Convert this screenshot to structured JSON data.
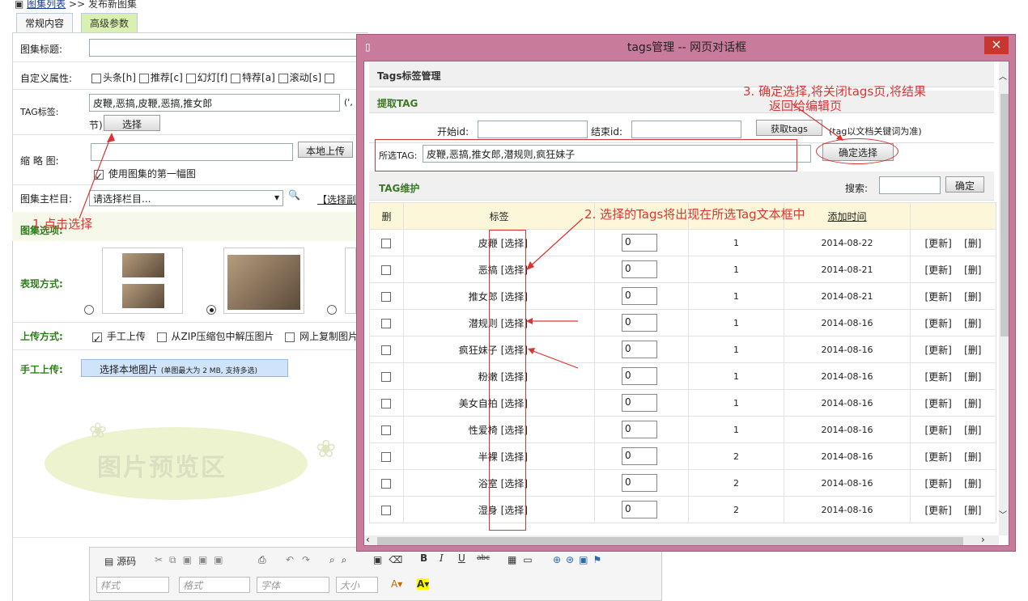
{
  "breadcrumb": {
    "link": "图集列表",
    "sep": ">>",
    "current": "发布新图集"
  },
  "tabs": [
    {
      "label": "常规内容"
    },
    {
      "label": "高级参数"
    }
  ],
  "form": {
    "title_label": "图集标题:",
    "attr_label": "自定义属性:",
    "attrs": [
      "头条[h]",
      "推荐[c]",
      "幻灯[f]",
      "特荐[a]",
      "滚动[s]"
    ],
    "tag_label": "TAG标签:",
    "tag_value": "皮鞭,恶搞,皮鞭,恶搞,推女郎",
    "tag_hint": "(',",
    "tag_hint2": "节)",
    "select_btn": "选择",
    "thumb_label": "缩 略 图:",
    "local_upload": "本地上传",
    "use_first": "使用图集的第一幅图",
    "column_label": "图集主栏目:",
    "column_value": "请选择栏目...",
    "column_link": "【选择副",
    "options_label": "图集选项:",
    "style_label": "表现方式:",
    "upload_label": "上传方式:",
    "upload_opts": [
      "手工上传",
      "从ZIP压缩包中解压图片",
      "网上复制图片"
    ],
    "manual_label": "手工上传:",
    "select_local": "选择本地图片",
    "select_local_hint": "(单图最大为 2 MB, 支持多选)",
    "preview_text": "图片预览区"
  },
  "annotations": {
    "a1": "1.点击选择",
    "a2": "2. 选择的Tags将出现在所选Tag文本框中",
    "a3": "3.  确定选择,将关闭tags页,将结果",
    "a3b": "返回给编辑页"
  },
  "dialog": {
    "title": "tags管理 -- 网页对话框",
    "close": "×",
    "section1": "Tags标签管理",
    "section2": "提取TAG",
    "start_label": "开始id:",
    "end_label": "结束id:",
    "fetch_btn": "获取tags",
    "fetch_hint": "(tag以文档关键词为准)",
    "selected_label": "所选TAG:",
    "selected_value": "皮鞭,恶搞,推女郎,潜规则,疯狂妹子",
    "confirm_btn": "确定选择",
    "section3": "TAG维护",
    "search_label": "搜索:",
    "search_btn": "确定",
    "headers": [
      "删",
      "标签",
      "",
      "",
      "添加时间",
      ""
    ],
    "rows": [
      {
        "tag": "皮鞭",
        "pick": "[选择]",
        "num": "0",
        "count": "1",
        "date": "2014-08-22",
        "upd": "[更新]",
        "del": "[删]"
      },
      {
        "tag": "恶搞",
        "pick": "[选择]",
        "num": "0",
        "count": "1",
        "date": "2014-08-21",
        "upd": "[更新]",
        "del": "[删]"
      },
      {
        "tag": "推女郎",
        "pick": "[选择]",
        "num": "0",
        "count": "1",
        "date": "2014-08-21",
        "upd": "[更新]",
        "del": "[删]"
      },
      {
        "tag": "潜规则",
        "pick": "[选择]",
        "num": "0",
        "count": "1",
        "date": "2014-08-16",
        "upd": "[更新]",
        "del": "[删]"
      },
      {
        "tag": "疯狂妹子",
        "pick": "[选择]",
        "num": "0",
        "count": "1",
        "date": "2014-08-16",
        "upd": "[更新]",
        "del": "[删]"
      },
      {
        "tag": "粉嫩",
        "pick": "[选择]",
        "num": "0",
        "count": "1",
        "date": "2014-08-16",
        "upd": "[更新]",
        "del": "[删]"
      },
      {
        "tag": "美女自拍",
        "pick": "[选择]",
        "num": "0",
        "count": "1",
        "date": "2014-08-16",
        "upd": "[更新]",
        "del": "[删]"
      },
      {
        "tag": "性爱椅",
        "pick": "[选择]",
        "num": "0",
        "count": "1",
        "date": "2014-08-16",
        "upd": "[更新]",
        "del": "[删]"
      },
      {
        "tag": "半裸",
        "pick": "[选择]",
        "num": "0",
        "count": "2",
        "date": "2014-08-16",
        "upd": "[更新]",
        "del": "[删]"
      },
      {
        "tag": "浴室",
        "pick": "[选择]",
        "num": "0",
        "count": "2",
        "date": "2014-08-16",
        "upd": "[更新]",
        "del": "[删]"
      },
      {
        "tag": "湿身",
        "pick": "[选择]",
        "num": "0",
        "count": "2",
        "date": "2014-08-16",
        "upd": "[更新]",
        "del": "[删]"
      }
    ]
  },
  "editor": {
    "source": "源码",
    "style": "样式",
    "format": "格式",
    "font": "字体",
    "size": "大小"
  }
}
